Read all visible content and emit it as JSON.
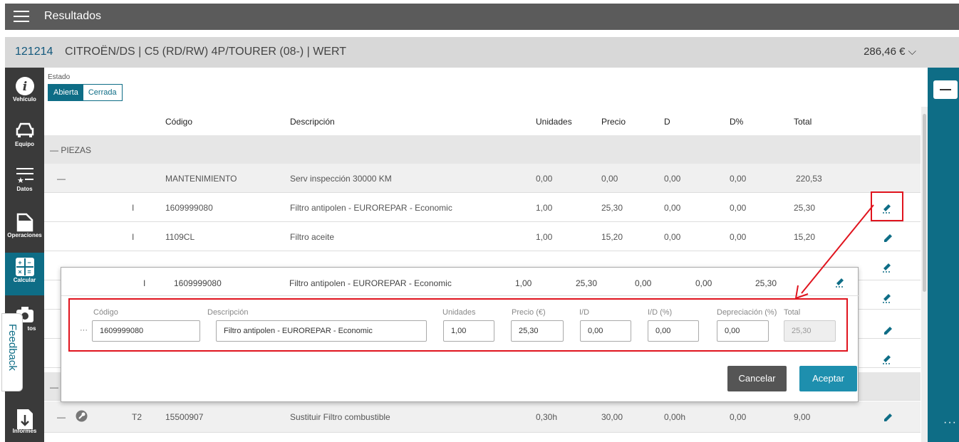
{
  "app": {
    "title": "Resultados"
  },
  "vehicle": {
    "id": "121214",
    "name": "CITROËN/DS | C5 (RD/RW) 4P/TOURER (08-) | WERT",
    "price": "286,46 €"
  },
  "nav": [
    {
      "label": "Vehículo",
      "icon": "info-icon"
    },
    {
      "label": "Equipo",
      "icon": "car-icon"
    },
    {
      "label": "Datos",
      "icon": "list-star-icon"
    },
    {
      "label": "Operaciones",
      "icon": "door-icon"
    },
    {
      "label": "Calcular",
      "icon": "calculator-icon"
    },
    {
      "label": "tos",
      "icon": "camera-icon"
    },
    {
      "label": "Informes",
      "icon": "download-icon"
    }
  ],
  "feedback": "Feedback",
  "estado": {
    "label": "Estado",
    "tabs": [
      "Abierta",
      "Cerrada"
    ]
  },
  "table": {
    "headers": {
      "codigo": "Código",
      "descripcion": "Descripción",
      "unidades": "Unidades",
      "precio": "Precio",
      "d": "D",
      "dpct": "D%",
      "total": "Total"
    },
    "group": "— PIEZAS",
    "sub": {
      "dash": "—",
      "codigo": "MANTENIMIENTO",
      "descripcion": "Serv inspección 30000 KM",
      "unidades": "0,00",
      "precio": "0,00",
      "d": "0,00",
      "dpct": "0,00",
      "total": "220,53"
    },
    "rows": [
      {
        "mark": "I",
        "codigo": "1609999080",
        "descripcion": "Filtro antipolen - EUROREPAR - Economic",
        "unidades": "1,00",
        "precio": "25,30",
        "d": "0,00",
        "dpct": "0,00",
        "total": "25,30"
      },
      {
        "mark": "I",
        "codigo": "1109CL",
        "descripcion": "Filtro aceite",
        "unidades": "1,00",
        "precio": "15,20",
        "d": "0,00",
        "dpct": "0,00",
        "total": "15,20"
      }
    ],
    "last": {
      "dash": "—",
      "mark": "T2",
      "codigo": "15500907",
      "descripcion": "Sustituir Filtro combustible",
      "unidades": "0,30h",
      "precio": "30,00",
      "d": "0,00h",
      "dpct": "0,00",
      "total": "9,00"
    }
  },
  "modal": {
    "row": {
      "mark": "I",
      "codigo": "1609999080",
      "descripcion": "Filtro antipolen - EUROREPAR - Economic",
      "unidades": "1,00",
      "precio": "25,30",
      "d": "0,00",
      "dpct": "0,00",
      "total": "25,30"
    },
    "labels": {
      "codigo": "Código",
      "descripcion": "Descripción",
      "unidades": "Unidades",
      "precio": "Precio (€)",
      "id": "I/D",
      "idpct": "I/D (%)",
      "depr": "Depreciación (%)",
      "total": "Total"
    },
    "values": {
      "ellipsis": "···",
      "codigo": "1609999080",
      "descripcion": "Filtro antipolen - EUROREPAR - Economic",
      "unidades": "1,00",
      "precio": "25,30",
      "id": "0,00",
      "idpct": "0,00",
      "depr": "0,00",
      "total": "25,30"
    },
    "cancel": "Cancelar",
    "accept": "Aceptar"
  },
  "colors": {
    "accent": "#0e6d86",
    "highlight": "#e0141e",
    "topbar": "#5b5b5b"
  }
}
